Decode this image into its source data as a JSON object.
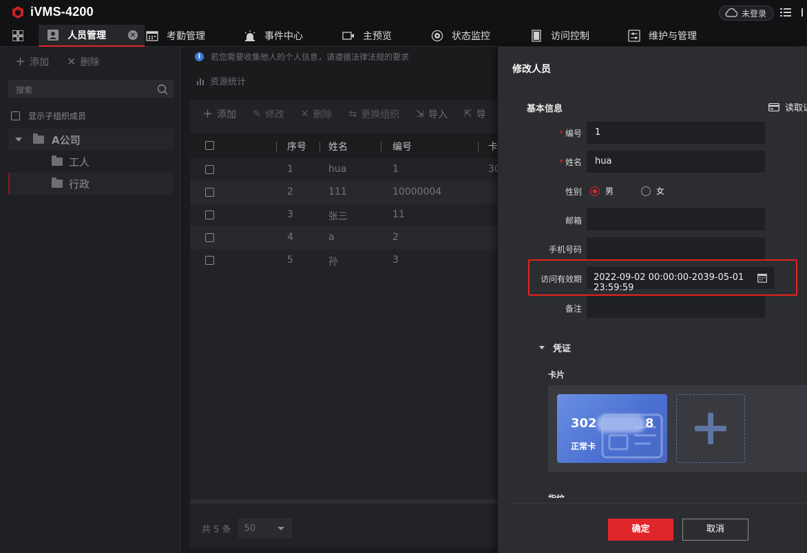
{
  "app": {
    "title": "iVMS-4200",
    "login_status": "未登录"
  },
  "tabs": [
    {
      "label": "人员管理",
      "icon": "person-card-icon",
      "active": true
    },
    {
      "label": "考勤管理",
      "icon": "calendar-icon"
    },
    {
      "label": "事件中心",
      "icon": "alarm-icon"
    },
    {
      "label": "主预览",
      "icon": "camera-icon"
    },
    {
      "label": "状态监控",
      "icon": "monitor-icon"
    },
    {
      "label": "访问控制",
      "icon": "door-icon"
    },
    {
      "label": "维护与管理",
      "icon": "settings-sliders-icon"
    }
  ],
  "sidebar": {
    "add_label": "添加",
    "delete_label": "删除",
    "search_placeholder": "搜索",
    "show_sub_label": "显示子组织成员",
    "tree": [
      {
        "label": "A公司",
        "level": 0
      },
      {
        "label": "工人",
        "level": 1
      },
      {
        "label": "行政",
        "level": 1,
        "selected": true
      }
    ]
  },
  "main": {
    "notice": "若您需要收集他人的个人信息，请遵循法律法规的要求",
    "res_stats": "资源统计",
    "toolbar": [
      "添加",
      "修改",
      "删除",
      "更换组织",
      "导入",
      "导"
    ],
    "columns": [
      "序号",
      "姓名",
      "编号",
      "卡"
    ],
    "rows": [
      {
        "seq": "1",
        "name": "hua",
        "no": "1",
        "card": "30"
      },
      {
        "seq": "2",
        "name": "111",
        "no": "10000004",
        "card": ""
      },
      {
        "seq": "3",
        "name": "张三",
        "no": "11",
        "card": ""
      },
      {
        "seq": "4",
        "name": "a",
        "no": "2",
        "card": ""
      },
      {
        "seq": "5",
        "name": "孙",
        "no": "3",
        "card": ""
      }
    ],
    "total_text": "共 5 条",
    "page_size": "50"
  },
  "modal": {
    "title": "修改人员",
    "section_basic": "基本信息",
    "read_card": "读取证",
    "fields": {
      "no_label": "编号",
      "no_value": "1",
      "name_label": "姓名",
      "name_value": "hua",
      "gender_label": "性别",
      "gender_male": "男",
      "gender_female": "女",
      "email_label": "邮箱",
      "email_value": "",
      "phone_label": "手机号码",
      "phone_value": "",
      "validity_label": "访问有效期",
      "validity_value": "2022-09-02 00:00:00-2039-05-01 23:59:59",
      "remark_label": "备注",
      "remark_value": ""
    },
    "credential_title": "凭证",
    "card_label": "卡片",
    "card": {
      "number_start": "302",
      "number_end": "8",
      "type": "正常卡"
    },
    "fingerprint_label": "指纹",
    "ok_label": "确定",
    "cancel_label": "取消"
  },
  "colors": {
    "accent": "#e0262b",
    "card_blue": "#5a7fdc",
    "highlight": "#e8221d"
  }
}
